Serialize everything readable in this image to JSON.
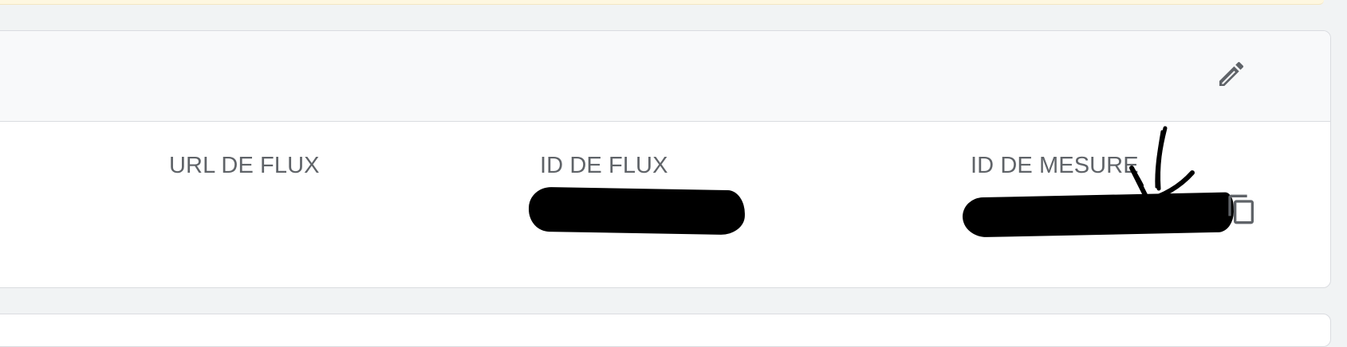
{
  "stream_details": {
    "columns": [
      {
        "label": "URL DE FLUX",
        "value": ""
      },
      {
        "label": "ID DE FLUX",
        "value": ""
      },
      {
        "label": "ID DE MESURE",
        "value": ""
      }
    ]
  },
  "icons": {
    "edit": "pencil-icon",
    "copy": "copy-icon"
  },
  "colors": {
    "background": "#f1f3f4",
    "card": "#ffffff",
    "header": "#f8f9fa",
    "border": "#dadce0",
    "label_text": "#5f6368",
    "banner": "#fef7e0"
  }
}
